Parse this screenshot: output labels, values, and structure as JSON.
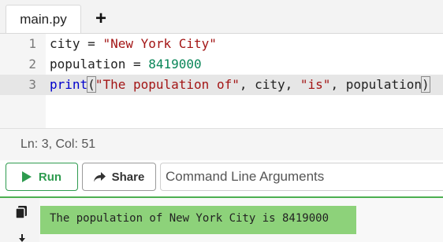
{
  "tabs": [
    {
      "label": "main.py",
      "active": true
    }
  ],
  "add_tab_label": "+",
  "editor": {
    "lines": [
      {
        "num": "1",
        "tokens": [
          "city",
          " = ",
          "\"New York City\""
        ]
      },
      {
        "num": "2",
        "tokens": [
          "population",
          " = ",
          "8419000"
        ]
      },
      {
        "num": "3",
        "tokens": [
          "print",
          "(",
          "\"The population of\"",
          ", city, ",
          "\"is\"",
          ", population",
          ")"
        ]
      }
    ],
    "active_line": 3
  },
  "status": {
    "text": "Ln: 3,  Col: 51"
  },
  "controls": {
    "run_label": "Run",
    "share_label": "Share",
    "args_placeholder": "Command Line Arguments"
  },
  "output": {
    "text": "The population of New York City is 8419000"
  },
  "colors": {
    "run_accent": "#2e9b4f",
    "output_bg": "#8dd27a",
    "string": "#a31515",
    "number": "#098658",
    "function": "#0000cc"
  },
  "icons": {
    "run": "play-icon",
    "share": "share-arrow-icon",
    "copy": "copy-icon",
    "download": "download-icon"
  }
}
